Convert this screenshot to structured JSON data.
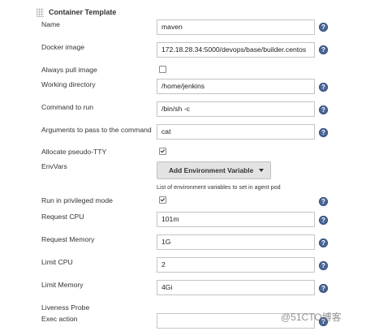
{
  "section": {
    "title": "Container Template"
  },
  "fields": {
    "name": {
      "label": "Name",
      "value": "maven"
    },
    "docker_image": {
      "label": "Docker image",
      "value": "172.18.28.34:5000/devops/base/builder.centos"
    },
    "always_pull": {
      "label": "Always pull image",
      "checked": false
    },
    "working_dir": {
      "label": "Working directory",
      "value": "/home/jenkins"
    },
    "command": {
      "label": "Command to run",
      "value": "/bin/sh -c"
    },
    "arguments": {
      "label": "Arguments to pass to the command",
      "value": "cat"
    },
    "tty": {
      "label": "Allocate pseudo-TTY",
      "checked": true
    },
    "envvars": {
      "label": "EnvVars",
      "button_label": "Add Environment Variable",
      "hint": "List of environment variables to set in agent pod"
    },
    "privileged": {
      "label": "Run in privileged mode",
      "checked": true
    },
    "request_cpu": {
      "label": "Request CPU",
      "value": "101m"
    },
    "request_memory": {
      "label": "Request Memory",
      "value": "1G"
    },
    "limit_cpu": {
      "label": "Limit CPU",
      "value": "2"
    },
    "limit_memory": {
      "label": "Limit Memory",
      "value": "4Gi"
    },
    "liveness": {
      "label": "Liveness Probe"
    },
    "exec_action": {
      "label": "Exec action",
      "value": ""
    }
  },
  "help_icon_glyph": "?",
  "watermark": "@51CTO博客",
  "colors": {
    "help_icon": "#4d6796",
    "dropdown_bg": "#e3e3e3",
    "input_border": "#c4c4c4"
  }
}
